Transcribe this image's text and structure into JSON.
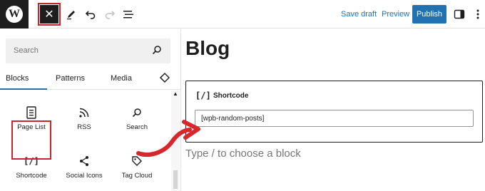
{
  "toolbar": {
    "logo_letter": "W",
    "close_glyph": "✕",
    "save_draft_label": "Save draft",
    "preview_label": "Preview",
    "publish_label": "Publish"
  },
  "inserter": {
    "search_placeholder": "Search",
    "tabs": [
      {
        "label": "Blocks",
        "active": true
      },
      {
        "label": "Patterns",
        "active": false
      },
      {
        "label": "Media",
        "active": false
      }
    ],
    "blocks": [
      {
        "label": "Page List",
        "icon": "page-list-icon"
      },
      {
        "label": "RSS",
        "icon": "rss-icon"
      },
      {
        "label": "Search",
        "icon": "search-icon"
      },
      {
        "label": "Shortcode",
        "icon": "shortcode-icon",
        "glyph": "[/]",
        "highlighted": true
      },
      {
        "label": "Social Icons",
        "icon": "share-icon"
      },
      {
        "label": "Tag Cloud",
        "icon": "tag-icon"
      }
    ]
  },
  "editor": {
    "post_title": "Blog",
    "shortcode_block": {
      "icon_glyph": "[/]",
      "label": "Shortcode",
      "value": "[wpb-random-posts]"
    },
    "appender_placeholder": "Type / to choose a block"
  },
  "colors": {
    "accent": "#2271b1",
    "highlight": "#c9252d",
    "dark": "#1e1e1e"
  }
}
